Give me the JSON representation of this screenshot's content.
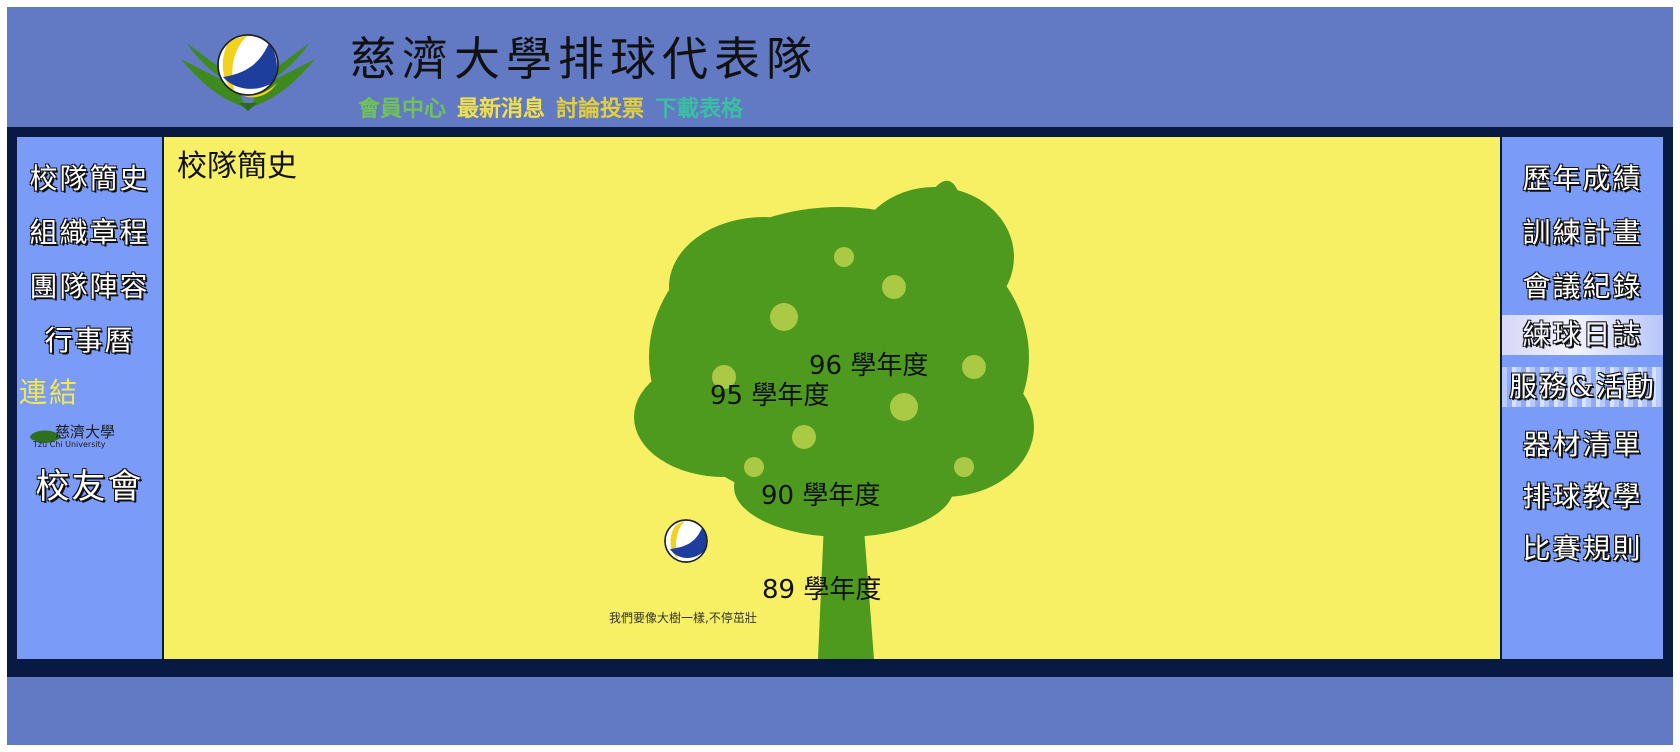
{
  "header": {
    "title": "慈濟大學排球代表隊",
    "nav": [
      {
        "label": "會員中心",
        "color": "#6fc25a"
      },
      {
        "label": "最新消息",
        "color": "#f0e14a"
      },
      {
        "label": "討論投票",
        "color": "#e2cf3b"
      },
      {
        "label": "下載表格",
        "color": "#3bbfa3"
      }
    ]
  },
  "left_menu": {
    "items": [
      "校隊簡史",
      "組織章程",
      "團隊陣容",
      "行事曆"
    ],
    "link_label": "連結",
    "uni_name": "慈濟大學",
    "uni_sub": "Tzu Chi University",
    "alumni": "校友會"
  },
  "right_menu": {
    "items": [
      "歷年成績",
      "訓練計畫",
      "會議紀錄",
      "練球日誌",
      "服務&活動",
      "器材清單",
      "排球教學",
      "比賽規則"
    ]
  },
  "main": {
    "heading": "校隊簡史",
    "years": [
      "96 學年度",
      "95 學年度",
      "90 學年度",
      "89 學年度"
    ],
    "caption": "我們要像大樹一樣,不停茁壯"
  },
  "colors": {
    "page_bg": "#6279c4",
    "frame_dark": "#081a42",
    "side_panel": "#7b9bf8",
    "main_bg": "#f7f064",
    "tree_green": "#4d9a1f"
  },
  "icons": [
    "volleyball-emblem-icon",
    "volleyball-icon",
    "tzu-chi-lotus-icon"
  ]
}
